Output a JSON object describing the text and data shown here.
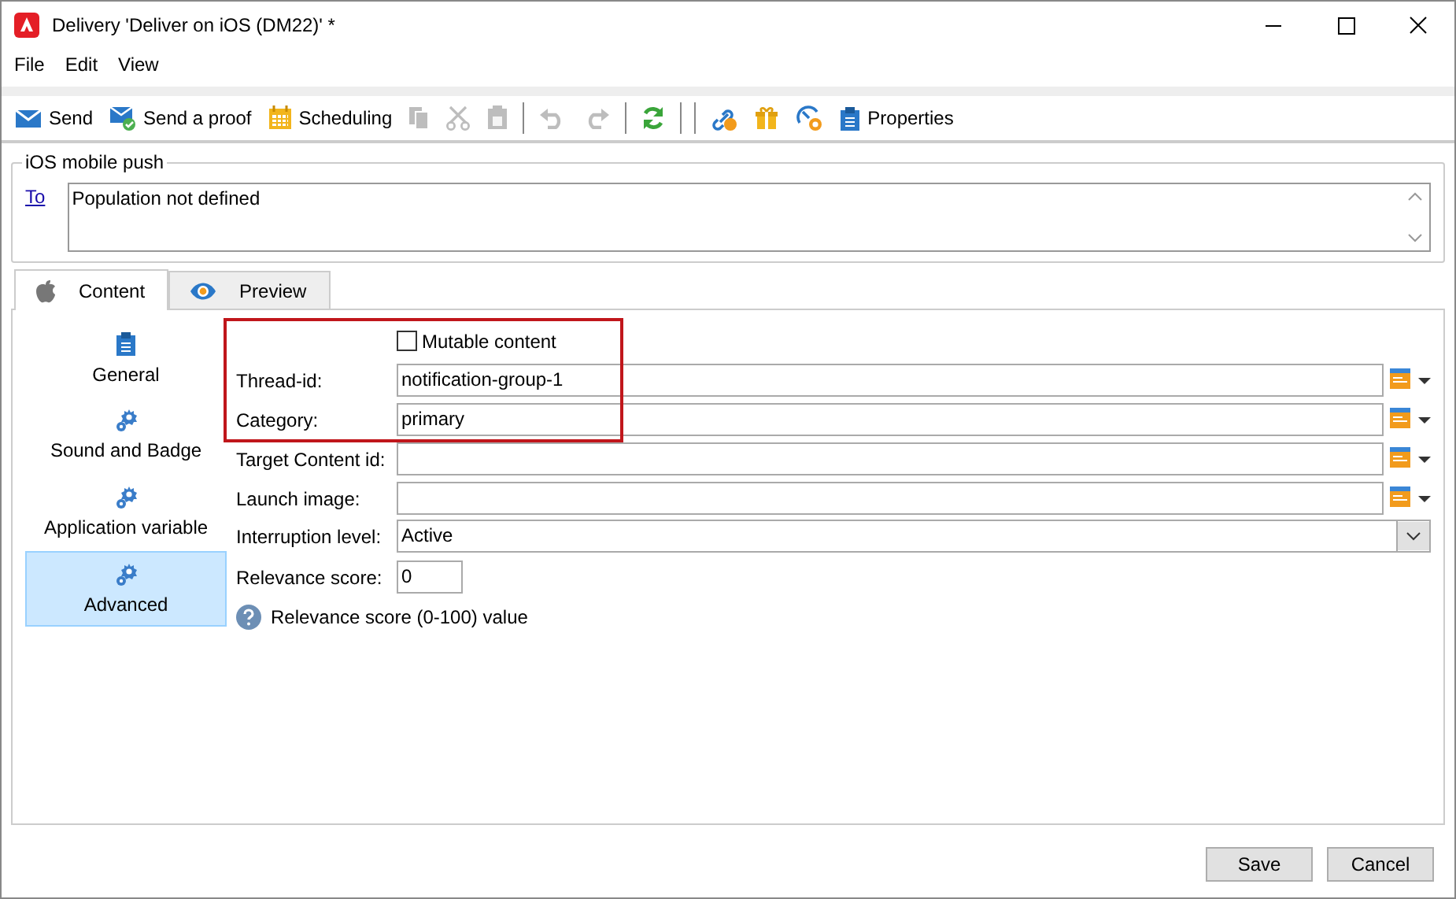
{
  "window": {
    "title": "Delivery 'Deliver on iOS (DM22)' *"
  },
  "menu": [
    "File",
    "Edit",
    "View"
  ],
  "toolbar": [
    {
      "kind": "send",
      "label": "Send",
      "disabled": false
    },
    {
      "kind": "proof",
      "label": "Send a proof",
      "disabled": false
    },
    {
      "kind": "calendar",
      "label": "Scheduling",
      "disabled": false
    },
    {
      "kind": "copy",
      "disabled": true
    },
    {
      "kind": "cut",
      "disabled": true
    },
    {
      "kind": "paste",
      "disabled": true
    },
    {
      "kind": "separator"
    },
    {
      "kind": "undo",
      "disabled": true
    },
    {
      "kind": "redo",
      "disabled": true
    },
    {
      "kind": "separator"
    },
    {
      "kind": "refresh",
      "disabled": false
    },
    {
      "kind": "separator"
    },
    {
      "kind": "separator"
    },
    {
      "kind": "link",
      "disabled": false
    },
    {
      "kind": "gift",
      "disabled": false
    },
    {
      "kind": "gauge",
      "disabled": false
    },
    {
      "kind": "clipboard",
      "label": "Properties",
      "disabled": false
    }
  ],
  "group": {
    "title": "iOS mobile push",
    "to_link": "To",
    "to_value": "Population not defined"
  },
  "tabs": [
    {
      "kind": "apple",
      "label": "Content",
      "selected": true
    },
    {
      "kind": "eye",
      "label": "Preview",
      "selected": false
    }
  ],
  "sidebar": {
    "items": [
      {
        "kind": "clipboard",
        "label": "General",
        "selected": false
      },
      {
        "kind": "gears",
        "label": "Sound and Badge",
        "selected": false
      },
      {
        "kind": "gears",
        "label": "Application variable",
        "selected": false
      },
      {
        "kind": "gears",
        "label": "Advanced",
        "selected": true
      }
    ]
  },
  "sections": [
    {
      "highlighted": true,
      "fields": [
        {
          "kind": "checkbox",
          "label": "Mutable content",
          "checked": false
        },
        {
          "kind": "text",
          "label": "Thread-id:",
          "value": "notification-group-1"
        },
        {
          "kind": "text",
          "label": "Category:",
          "value": "primary"
        }
      ]
    },
    {
      "highlighted": false,
      "fields": [
        {
          "kind": "text",
          "label": "Target Content id:"
        },
        {
          "kind": "text",
          "label": "Launch image:"
        },
        {
          "kind": "select",
          "label": "Interruption level:",
          "value": "Active"
        },
        {
          "kind": "short",
          "label": "Relevance score:",
          "value": "0"
        },
        {
          "kind": "help",
          "label": "Relevance score (0-100) value"
        }
      ]
    }
  ],
  "buttons": [
    "Save",
    "Cancel"
  ]
}
